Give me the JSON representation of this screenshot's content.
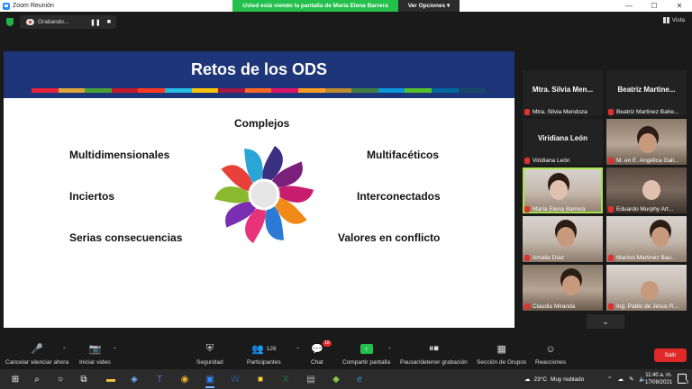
{
  "window": {
    "title": "Zoom Reunión",
    "share_banner": "Usted está viendo la pantalla de María Elena Barrera",
    "view_options": "Ver Opciones",
    "view_options_caret": "▾",
    "controls": {
      "minimize": "—",
      "maximize": "☐",
      "close": "✕"
    }
  },
  "meeting_top": {
    "recording_label": "Grabando...",
    "pause_glyph": "❚❚",
    "stop_glyph": "■",
    "view_label": "Vista"
  },
  "slide": {
    "title": "Retos de los ODS",
    "stripe_colors": [
      "#e5243b",
      "#dda63a",
      "#4c9f38",
      "#c5192d",
      "#ff3a21",
      "#26bde2",
      "#fcc30b",
      "#a21942",
      "#fd6925",
      "#dd1367",
      "#fd9d24",
      "#bf8b2e",
      "#3f7e44",
      "#0a97d9",
      "#56c02b",
      "#00689d",
      "#19486a"
    ],
    "labels": {
      "top": "Complejos",
      "left1": "Multidimensionales",
      "left2": "Inciertos",
      "left3": "Serias consecuencias",
      "right1": "Multifacéticos",
      "right2": "Interconectados",
      "right3": "Valores en conflicto"
    },
    "petal_colors": [
      "#3a2f80",
      "#7a1f7a",
      "#c81d6e",
      "#f28a1a",
      "#2c7ad6",
      "#e8327a",
      "#7a2fb2",
      "#8ab82e",
      "#e8413a",
      "#2aa6d6"
    ]
  },
  "participants": [
    {
      "big": "Mtra. Silvia Men...",
      "name": "Mtra. Silvia Mendoza"
    },
    {
      "big": "Beatriz Martine...",
      "name": "Beatriz Martinez Bahe..."
    },
    {
      "big": "Viridiana León",
      "name": "Viridiana León"
    },
    {
      "big": "",
      "name": "M. en E. Angélica Gali..."
    },
    {
      "big": "",
      "name": "María Elena Barrera"
    },
    {
      "big": "",
      "name": "Eduardo Murphy Art..."
    },
    {
      "big": "",
      "name": "Amalia Díaz"
    },
    {
      "big": "",
      "name": "Marisol Martinez Bau..."
    },
    {
      "big": "",
      "name": "Claudia Miranda"
    },
    {
      "big": "",
      "name": "Ing. Pablo de Jesus R..."
    }
  ],
  "more_tiles_glyph": "⌄",
  "toolbar": {
    "mute": "Cancelar silenciar ahora",
    "video": "Iniciar video",
    "security": "Seguridad",
    "participants": "Participantes",
    "participants_count": "128",
    "chat": "Chat",
    "chat_badge": "18",
    "share": "Compartir pantalla",
    "pause_share": "Pausar/detener grabación",
    "rooms": "Sección de Grupos",
    "reactions": "Reacciones",
    "leave": "Salir",
    "caret": "⌃"
  },
  "taskbar": {
    "weather_temp": "23°C",
    "weather_desc": "Muy nublado",
    "time": "11:40 a. m.",
    "date": "17/08/2021",
    "notif_count": "3"
  }
}
